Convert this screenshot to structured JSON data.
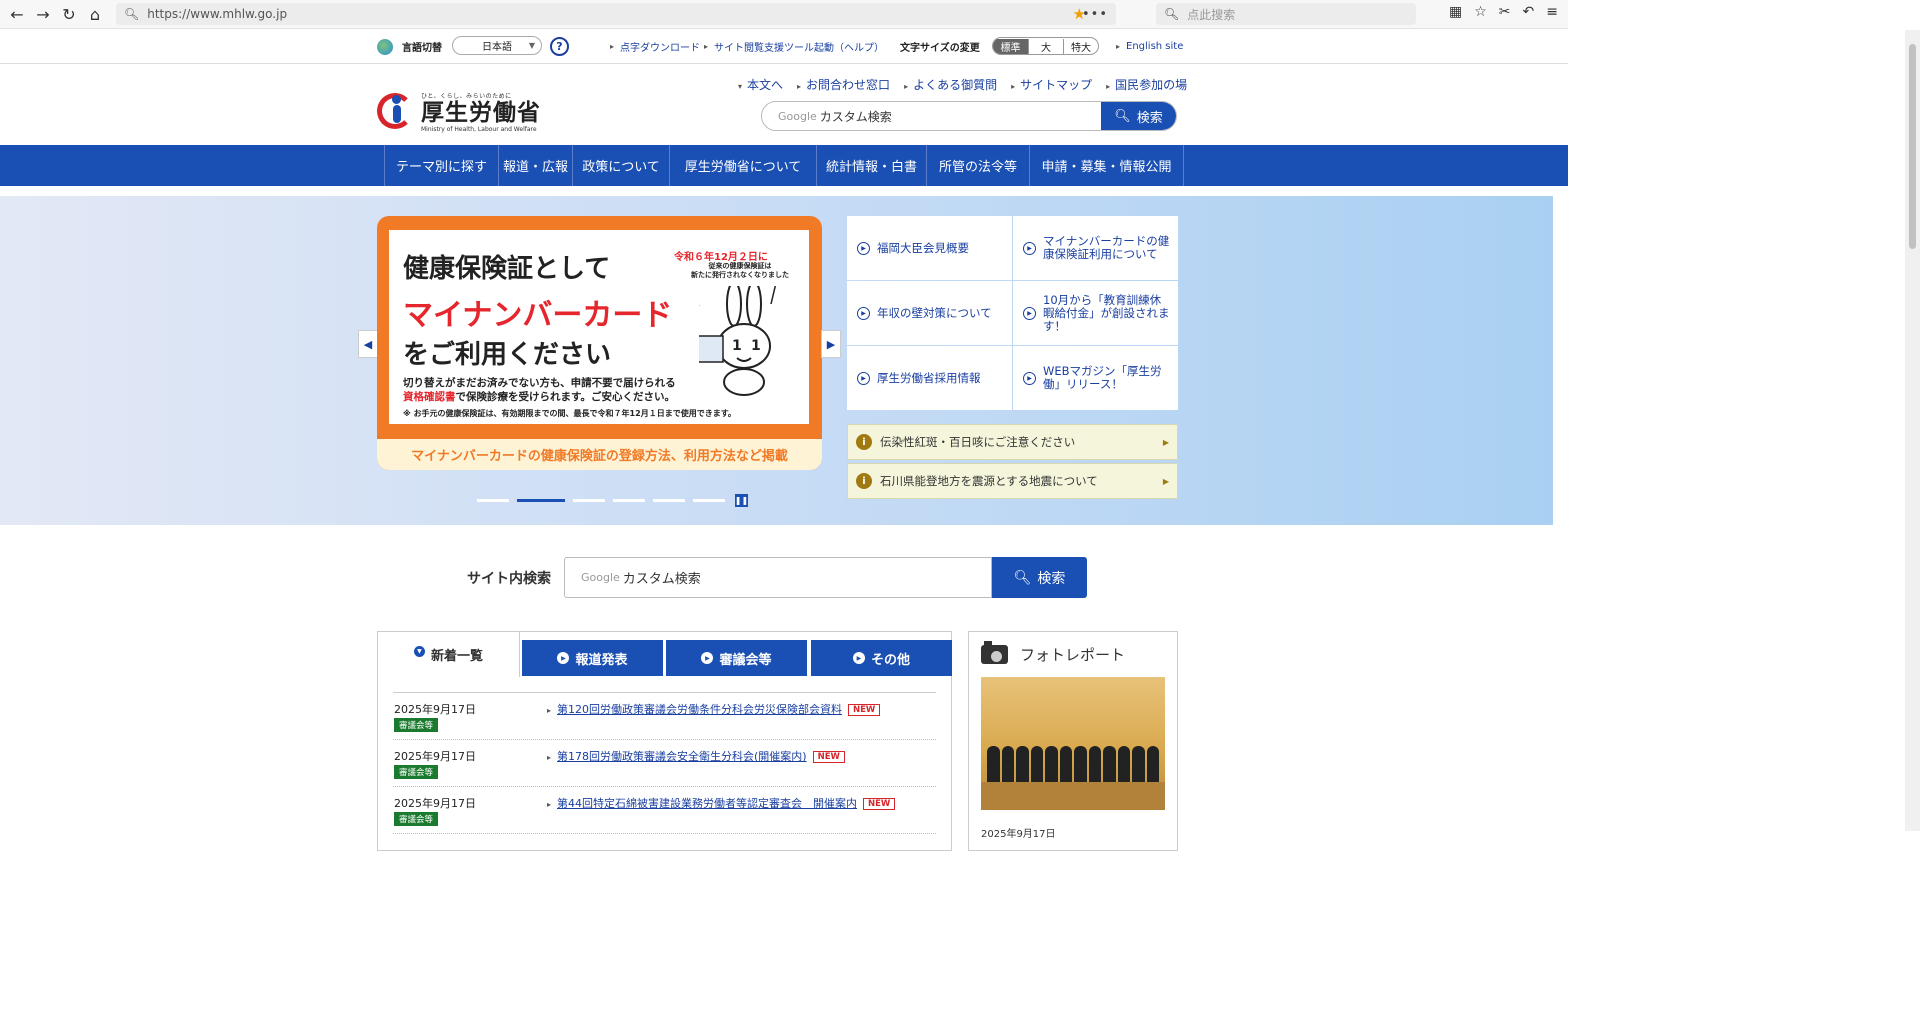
{
  "browser": {
    "url": "https://www.mhlw.go.jp",
    "search_placeholder": "点此搜索"
  },
  "utility": {
    "lang_label": "言語切替",
    "lang_value": "日本語",
    "help": "?",
    "links": [
      "点字ダウンロード",
      "サイト閲覧支援ツール起動",
      "（ヘルプ）"
    ],
    "fontsize_label": "文字サイズの変更",
    "fontsize_options": [
      "標準",
      "大",
      "特大"
    ],
    "english": "English site"
  },
  "header": {
    "tagline": "ひと、くらし、みらいのために",
    "ministry": "厚生労働省",
    "ministry_en": "Ministry of Health, Labour and Welfare",
    "links": [
      "本文へ",
      "お問合わせ窓口",
      "よくある御質問",
      "サイトマップ",
      "国民参加の場"
    ],
    "search_google": "Google",
    "search_placeholder": "カスタム検索",
    "search_button": "検索"
  },
  "mainnav": [
    "テーマ別に探す",
    "報道・広報",
    "政策について",
    "厚生労働省について",
    "統計情報・白書",
    "所管の法令等",
    "申請・募集・情報公開"
  ],
  "banner": {
    "line1": "健康保険証として",
    "line2": "マイナンバーカード",
    "line3": "をご利用ください",
    "date": "令和６年12月２日に",
    "date2": "従来の健康保険証は\n新たに発行されなくなりました",
    "sub1": "切り替えがまだお済みでない方も、申請不要で届けられる",
    "sub2_red": "資格確認書",
    "sub2": "で保険診療を受けられます。ご安心ください。",
    "note": "※ お手元の健康保険証は、有効期限までの間、最長で令和７年12月１日まで使用できます。",
    "bottom": "マイナンバーカードの健康保険証の登録方法、利用方法など掲載"
  },
  "tiles": [
    "福岡大臣会見概要",
    "マイナンバーカードの健康保険証利用について",
    "年収の壁対策について",
    "10月から「教育訓練休暇給付金」が創設されます！",
    "厚生労働省採用情報",
    "WEBマガジン「厚生労働」リリース！"
  ],
  "alerts": [
    "伝染性紅斑・百日咳にご注意ください",
    "石川県能登地方を震源とする地震について"
  ],
  "site_search": {
    "label": "サイト内検索",
    "google": "Google",
    "placeholder": "カスタム検索",
    "button": "検索"
  },
  "news": {
    "tabs": [
      "新着一覧",
      "報道発表",
      "審議会等",
      "その他"
    ],
    "items": [
      {
        "date": "2025年9月17日",
        "category": "審議会等",
        "title": "第120回労働政策審議会労働条件分科会労災保険部会資料",
        "badge": "NEW"
      },
      {
        "date": "2025年9月17日",
        "category": "審議会等",
        "title": "第178回労働政策審議会安全衛生分科会(開催案内)",
        "badge": "NEW"
      },
      {
        "date": "2025年9月17日",
        "category": "審議会等",
        "title": "第44回特定石綿被害建設業務労働者等認定審査会　開催案内",
        "badge": "NEW"
      }
    ]
  },
  "photo": {
    "title": "フォトレポート",
    "date": "2025年9月17日"
  }
}
